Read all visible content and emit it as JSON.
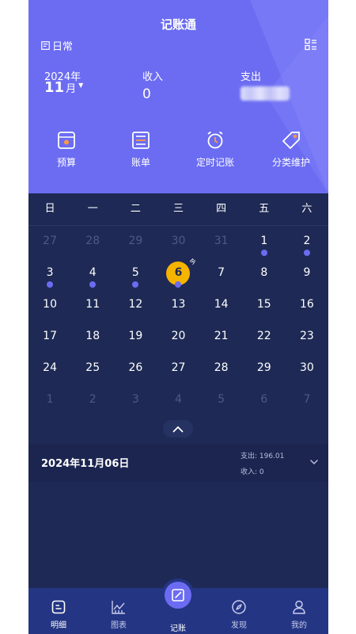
{
  "header": {
    "title": "记账通",
    "mode_label": "日常"
  },
  "summary": {
    "year": "2024年",
    "month": "11",
    "month_suffix": "月",
    "income_label": "收入",
    "income_value": "0",
    "expense_label": "支出"
  },
  "actions": [
    {
      "label": "预算",
      "icon": "budget-icon"
    },
    {
      "label": "账单",
      "icon": "bill-icon"
    },
    {
      "label": "定时记账",
      "icon": "alarm-icon"
    },
    {
      "label": "分类维护",
      "icon": "tag-icon"
    }
  ],
  "weekdays": [
    "日",
    "一",
    "二",
    "三",
    "四",
    "五",
    "六"
  ],
  "calendar": {
    "today_mark": "今",
    "rows": [
      [
        "27",
        "28",
        "29",
        "30",
        "31",
        "1",
        "2"
      ],
      [
        "3",
        "4",
        "5",
        "6",
        "7",
        "8",
        "9"
      ],
      [
        "10",
        "11",
        "12",
        "13",
        "14",
        "15",
        "16"
      ],
      [
        "17",
        "18",
        "19",
        "20",
        "21",
        "22",
        "23"
      ],
      [
        "24",
        "25",
        "26",
        "27",
        "28",
        "29",
        "30"
      ],
      [
        "1",
        "2",
        "3",
        "4",
        "5",
        "6",
        "7"
      ]
    ]
  },
  "day_detail": {
    "date": "2024年11月06日",
    "expense": "支出:  196.01",
    "income": "收入:  0"
  },
  "bottom_nav": [
    {
      "label": "明细",
      "icon": "detail-icon"
    },
    {
      "label": "图表",
      "icon": "chart-icon"
    },
    {
      "label": "记账",
      "icon": "edit-icon"
    },
    {
      "label": "发现",
      "icon": "compass-icon"
    },
    {
      "label": "我的",
      "icon": "user-icon"
    }
  ],
  "colors": {
    "accent": "#6b6cf2",
    "background": "#1e2a55",
    "today": "#f5b400",
    "nav": "#243584"
  }
}
